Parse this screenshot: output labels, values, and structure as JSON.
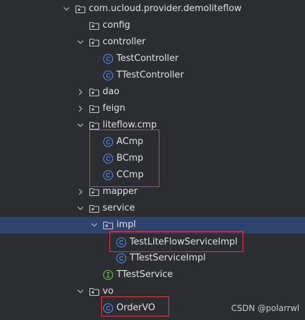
{
  "tree": {
    "root_package": "com.ucloud.provider.demoliteflow",
    "config": "config",
    "controller": "controller",
    "test_controller": "TestController",
    "ttest_controller": "TTestController",
    "dao": "dao",
    "feign": "feign",
    "liteflow_cmp": "liteflow.cmp",
    "acmp": "ACmp",
    "bcmp": "BCmp",
    "ccmp": "CCmp",
    "mapper": "mapper",
    "service": "service",
    "impl": "impl",
    "test_liteflow_service_impl": "TestLiteFlowServiceImpl",
    "ttest_service_impl": "TTestServiceImpl",
    "ttest_service": "TTestService",
    "vo": "vo",
    "order_vo": "OrderVO"
  },
  "watermark": "CSDN @polarrwl",
  "colors": {
    "background": "#2b2d30",
    "selected_row": "#2e436e",
    "highlight_box": "#e03b4a",
    "class_icon": "#4a7fd4",
    "interface_icon": "#5faa4a",
    "text": "#dfe1e5"
  }
}
